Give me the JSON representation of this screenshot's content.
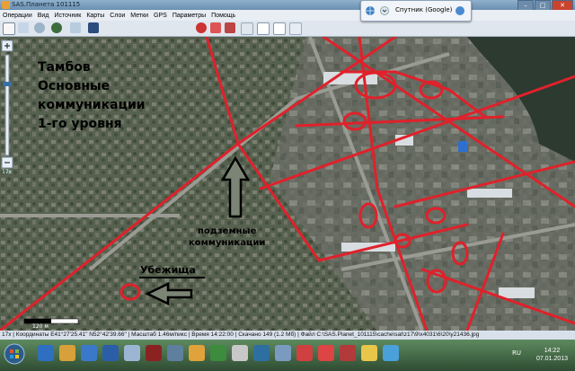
{
  "window": {
    "title": "SAS.Планета 101115"
  },
  "menu": [
    "Операции",
    "Вид",
    "Источник",
    "Карты",
    "Слои",
    "Метки",
    "GPS",
    "Параметры",
    "Помощь"
  ],
  "layer_panel": {
    "source_label": "Спутник (Google)"
  },
  "zoom": {
    "level": "17x"
  },
  "map": {
    "heading_lines": [
      "Тамбов",
      "Основные",
      "коммуникации",
      "1-го уровня"
    ],
    "underground_label_lines": [
      "подземные",
      "коммуникации"
    ],
    "shelter_label": "Убежища",
    "scale_text": "120 м",
    "colors": {
      "route": "#e0212b",
      "arrow_outline": "#000000"
    }
  },
  "status": {
    "text": "17x | Координаты E41°27'25.41\" N52°42'39.66\" | Масштаб 1.46м/пикс | Время 14:22:00 | Скачано 149 (1.2 Мб) | Файл C:\\SAS.Planet_101115\\cache\\sat\\z17\\9\\x4031\\6\\20\\y21436.jpg"
  },
  "taskbar": {
    "tray_lang": "RU",
    "time": "14:22",
    "date": "07.01.2013"
  }
}
